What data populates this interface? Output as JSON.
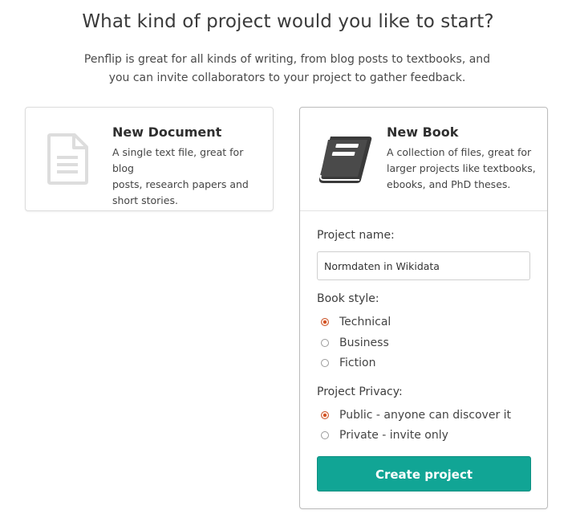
{
  "header": {
    "title": "What kind of project would you like to start?",
    "subtitle_line1": "Penflip is great for all kinds of writing, from blog posts to textbooks, and",
    "subtitle_line2": "you can invite collaborators to your project to gather feedback."
  },
  "cards": {
    "document": {
      "title": "New Document",
      "desc_line1": "A single text file, great for blog",
      "desc_line2": "posts, research papers and",
      "desc_line3": "short stories.",
      "icon": "document-icon"
    },
    "book": {
      "title": "New Book",
      "desc_line1": "A collection of files, great for",
      "desc_line2": "larger projects like textbooks,",
      "desc_line3": "ebooks, and PhD theses.",
      "icon": "book-icon"
    }
  },
  "form": {
    "project_name_label": "Project name:",
    "project_name_value": "Normdaten in Wikidata",
    "book_style_label": "Book style:",
    "book_styles": [
      {
        "label": "Technical",
        "checked": true
      },
      {
        "label": "Business",
        "checked": false
      },
      {
        "label": "Fiction",
        "checked": false
      }
    ],
    "privacy_label": "Project Privacy:",
    "privacy_options": [
      {
        "label": "Public - anyone can discover it",
        "checked": true
      },
      {
        "label": "Private - invite only",
        "checked": false
      }
    ],
    "submit_label": "Create project"
  },
  "colors": {
    "accent": "#11a595",
    "radio_selected": "#d24d1d",
    "icon_muted": "#dddddd",
    "icon_dark": "#3a3a3a"
  }
}
